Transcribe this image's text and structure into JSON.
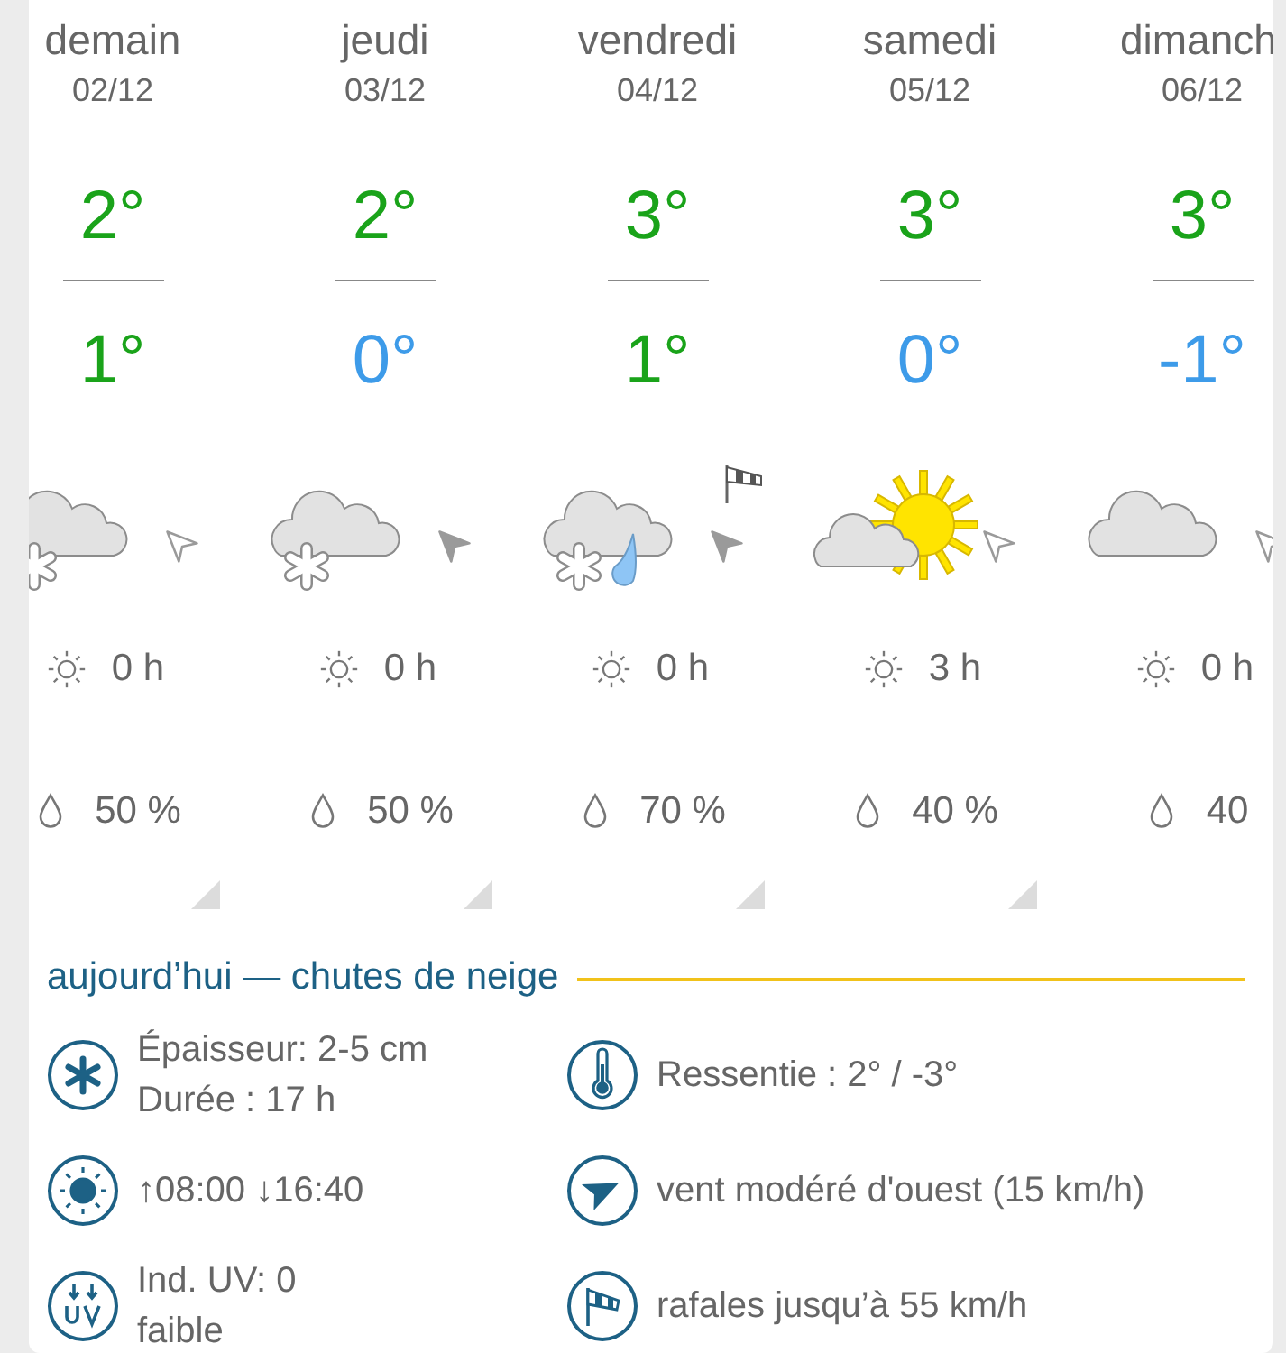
{
  "days": [
    {
      "name": "demain",
      "date": "02/12",
      "high": {
        "text": "2°",
        "color": "#1aa31a"
      },
      "low": {
        "text": "1°",
        "color": "#1aa31a"
      },
      "weather": {
        "kind": "snow"
      },
      "wind_arrow_filled": false,
      "gust_flag": false,
      "sun_hours": "0 h",
      "precip": "50 %",
      "corner_mark": true
    },
    {
      "name": "jeudi",
      "date": "03/12",
      "high": {
        "text": "2°",
        "color": "#1aa31a"
      },
      "low": {
        "text": "0°",
        "color": "#3d9be9"
      },
      "weather": {
        "kind": "snow"
      },
      "wind_arrow_filled": true,
      "gust_flag": false,
      "sun_hours": "0 h",
      "precip": "50 %",
      "corner_mark": true
    },
    {
      "name": "vendredi",
      "date": "04/12",
      "high": {
        "text": "3°",
        "color": "#1aa31a"
      },
      "low": {
        "text": "1°",
        "color": "#1aa31a"
      },
      "weather": {
        "kind": "sleet"
      },
      "wind_arrow_filled": true,
      "gust_flag": true,
      "sun_hours": "0 h",
      "precip": "70 %",
      "corner_mark": true
    },
    {
      "name": "samedi",
      "date": "05/12",
      "high": {
        "text": "3°",
        "color": "#1aa31a"
      },
      "low": {
        "text": "0°",
        "color": "#3d9be9"
      },
      "weather": {
        "kind": "sun-cloud"
      },
      "wind_arrow_filled": false,
      "gust_flag": false,
      "sun_hours": "3 h",
      "precip": "40 %",
      "corner_mark": true
    },
    {
      "name": "dimanch",
      "date": "06/12",
      "high": {
        "text": "3°",
        "color": "#1aa31a"
      },
      "low": {
        "text": "-1°",
        "color": "#3d9be9"
      },
      "weather": {
        "kind": "cloud"
      },
      "wind_arrow_filled": false,
      "gust_flag": false,
      "sun_hours": "0 h",
      "precip": "40",
      "corner_mark": false
    }
  ],
  "today": {
    "title": "aujourd’hui — chutes de neige",
    "details": [
      {
        "kind": "snow",
        "lines": [
          "Épaisseur: 2-5 cm",
          "Durée : 17 h"
        ]
      },
      {
        "kind": "temperature",
        "lines": [
          "Ressentie : 2° / -3°"
        ]
      },
      {
        "kind": "sun",
        "lines": [
          "↑08:00 ↓16:40"
        ]
      },
      {
        "kind": "wind",
        "lines": [
          "vent modéré d'ouest (15 km/h)"
        ]
      },
      {
        "kind": "uv",
        "lines": [
          "Ind. UV: 0",
          "faible"
        ]
      },
      {
        "kind": "gusts",
        "lines": [
          "rafales jusqu’à 55 km/h"
        ]
      }
    ]
  }
}
